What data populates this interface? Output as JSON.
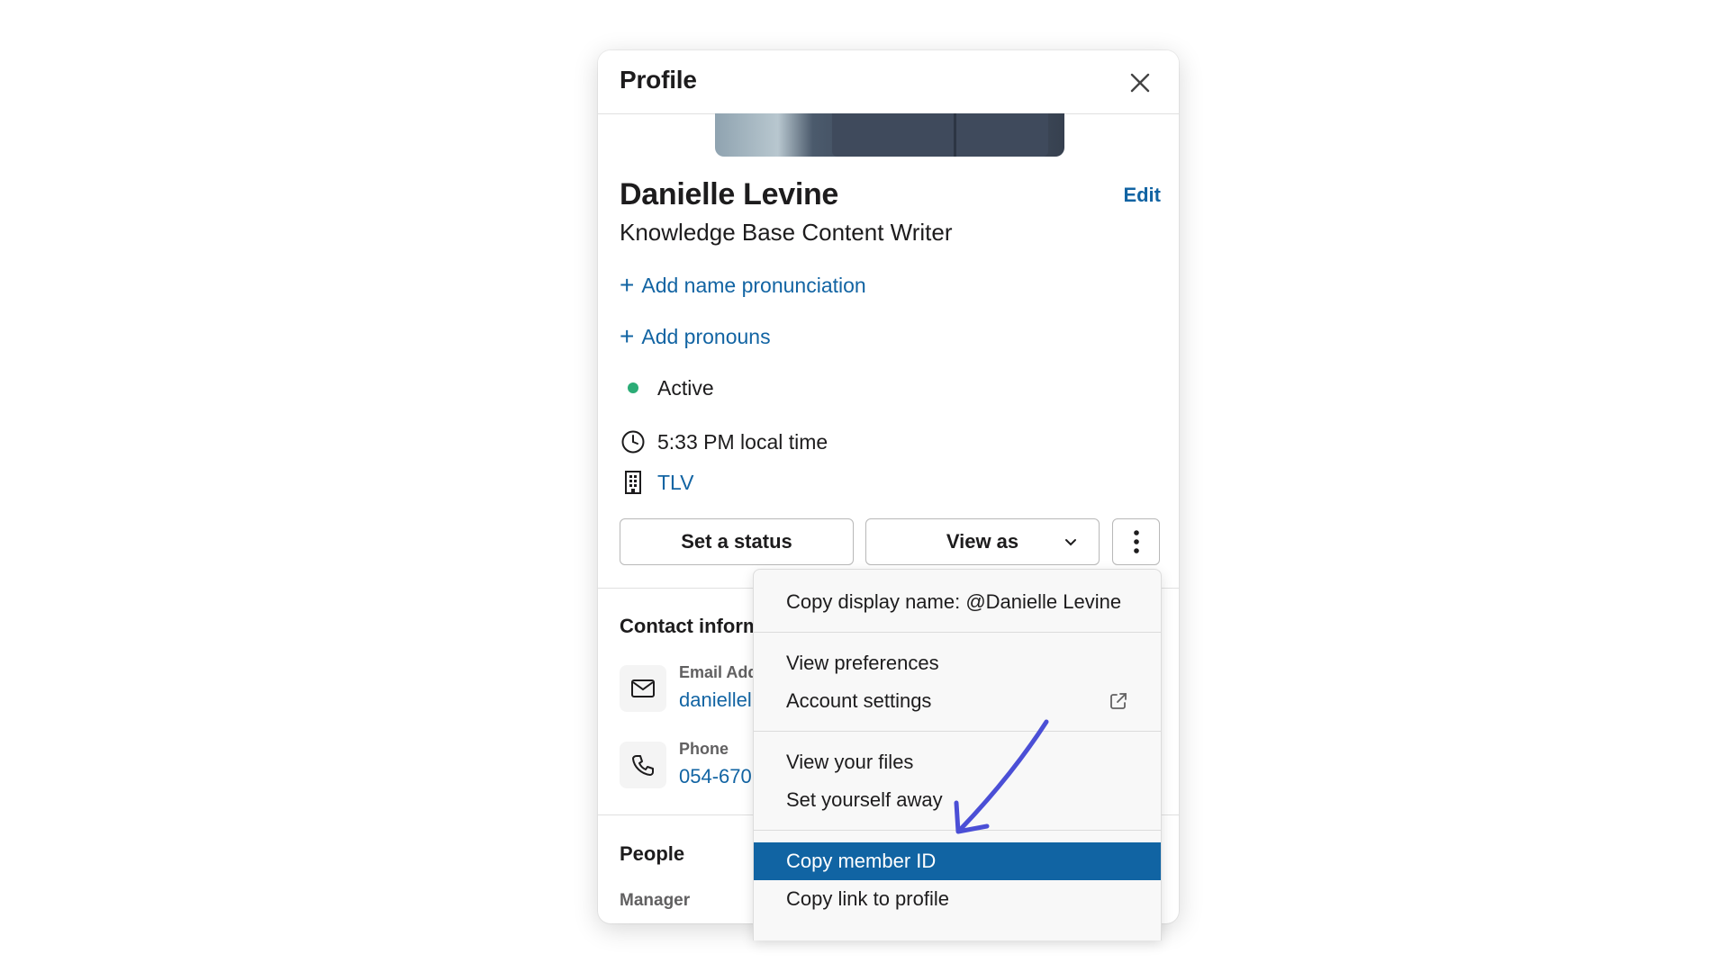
{
  "header": {
    "title": "Profile"
  },
  "profile": {
    "name": "Danielle Levine",
    "edit_label": "Edit",
    "job_title": "Knowledge Base Content Writer",
    "add_pronunciation": "Add name pronunciation",
    "add_pronouns": "Add pronouns",
    "status": "Active",
    "status_color": "#2bac76",
    "local_time": "5:33 PM local time",
    "location": "TLV"
  },
  "actions": {
    "set_status": "Set a status",
    "view_as": "View as"
  },
  "contact": {
    "title": "Contact inform",
    "email_label": "Email Add",
    "email_value": "daniellel",
    "phone_label": "Phone",
    "phone_value": "054-670"
  },
  "people": {
    "title": "People",
    "manager_label": "Manager"
  },
  "menu": {
    "items": [
      "Copy display name: @Danielle Levine",
      "View preferences",
      "Account settings",
      "View your files",
      "Set yourself away",
      "Copy member ID",
      "Copy link to profile"
    ],
    "selected": "Copy member ID"
  },
  "colors": {
    "link": "#1264a3",
    "selected_bg": "#1164a3",
    "annotation_arrow": "#4b4fd6"
  }
}
